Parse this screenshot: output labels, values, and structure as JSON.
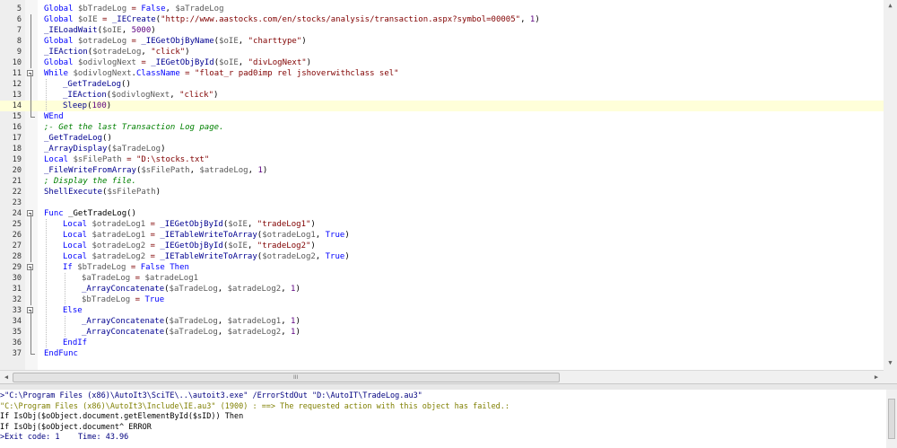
{
  "editor": {
    "current_line": 9,
    "lines": [
      {
        "n": "5",
        "fold": "line",
        "guides": [],
        "tokens": [
          [
            "kw",
            "Global "
          ],
          [
            "var",
            "$bTradeLog"
          ],
          [
            "op",
            " = "
          ],
          [
            "kw",
            "False"
          ],
          [
            "pn",
            ", "
          ],
          [
            "var",
            "$aTradeLog"
          ]
        ]
      },
      {
        "n": "6",
        "fold": "line",
        "guides": [],
        "tokens": [
          [
            "kw",
            "Global "
          ],
          [
            "var",
            "$oIE"
          ],
          [
            "op",
            " = "
          ],
          [
            "fn",
            "_IECreate"
          ],
          [
            "pn",
            "("
          ],
          [
            "str",
            "\"http://www.aastocks.com/en/stocks/analysis/transaction.aspx?symbol=00005\""
          ],
          [
            "pn",
            ", "
          ],
          [
            "num",
            "1"
          ],
          [
            "pn",
            ")"
          ]
        ]
      },
      {
        "n": "7",
        "fold": "line",
        "guides": [],
        "tokens": [
          [
            "fn",
            "_IELoadWait"
          ],
          [
            "pn",
            "("
          ],
          [
            "var",
            "$oIE"
          ],
          [
            "pn",
            ", "
          ],
          [
            "num",
            "5000"
          ],
          [
            "pn",
            ")"
          ]
        ]
      },
      {
        "n": "8",
        "fold": "line",
        "guides": [],
        "tokens": [
          [
            "kw",
            "Global "
          ],
          [
            "var",
            "$otradeLog"
          ],
          [
            "op",
            " = "
          ],
          [
            "fn",
            "_IEGetObjByName"
          ],
          [
            "pn",
            "("
          ],
          [
            "var",
            "$oIE"
          ],
          [
            "pn",
            ", "
          ],
          [
            "str",
            "\"charttype\""
          ],
          [
            "pn",
            ")"
          ]
        ]
      },
      {
        "n": "9",
        "fold": "line",
        "guides": [],
        "tokens": [
          [
            "fn",
            "_IEAction"
          ],
          [
            "pn",
            "("
          ],
          [
            "var",
            "$otradeLog"
          ],
          [
            "pn",
            ", "
          ],
          [
            "str",
            "\"click\""
          ],
          [
            "pn",
            ")"
          ]
        ]
      },
      {
        "n": "10",
        "fold": "line",
        "guides": [],
        "tokens": [
          [
            "kw",
            "Global "
          ],
          [
            "var",
            "$odivlogNext"
          ],
          [
            "op",
            " = "
          ],
          [
            "fn",
            "_IEGetObjById"
          ],
          [
            "pn",
            "("
          ],
          [
            "var",
            "$oIE"
          ],
          [
            "pn",
            ", "
          ],
          [
            "str",
            "\"divLogNext\""
          ],
          [
            "pn",
            ")"
          ]
        ]
      },
      {
        "n": "11",
        "fold": "open",
        "guides": [],
        "tokens": [
          [
            "kw",
            "While "
          ],
          [
            "var",
            "$odivlogNext"
          ],
          [
            "pn",
            "."
          ],
          [
            "ml",
            "ClassName"
          ],
          [
            "op",
            " = "
          ],
          [
            "str",
            "\"float_r pad0imp rel jshoverwithclass sel\""
          ]
        ]
      },
      {
        "n": "12",
        "fold": "line",
        "guides": [
          1
        ],
        "tokens": [
          [
            "fn",
            "_GetTradeLog"
          ],
          [
            "pn",
            "()"
          ]
        ]
      },
      {
        "n": "13",
        "fold": "line",
        "guides": [
          1
        ],
        "tokens": [
          [
            "fn",
            "_IEAction"
          ],
          [
            "pn",
            "("
          ],
          [
            "var",
            "$odivlogNext"
          ],
          [
            "pn",
            ", "
          ],
          [
            "str",
            "\"click\""
          ],
          [
            "pn",
            ")"
          ]
        ]
      },
      {
        "n": "14",
        "fold": "line",
        "guides": [
          1
        ],
        "tokens": [
          [
            "bi",
            "Sleep"
          ],
          [
            "pn",
            "("
          ],
          [
            "num",
            "100"
          ],
          [
            "pn",
            ")"
          ]
        ]
      },
      {
        "n": "15",
        "fold": "end",
        "guides": [],
        "tokens": [
          [
            "kw",
            "WEnd"
          ]
        ]
      },
      {
        "n": "16",
        "fold": "none",
        "guides": [],
        "tokens": [
          [
            "cm",
            ";- Get the last Transaction Log page."
          ]
        ]
      },
      {
        "n": "17",
        "fold": "none",
        "guides": [],
        "tokens": [
          [
            "fn",
            "_GetTradeLog"
          ],
          [
            "pn",
            "()"
          ]
        ]
      },
      {
        "n": "18",
        "fold": "none",
        "guides": [],
        "tokens": [
          [
            "fn",
            "_ArrayDisplay"
          ],
          [
            "pn",
            "("
          ],
          [
            "var",
            "$aTradeLog"
          ],
          [
            "pn",
            ")"
          ]
        ]
      },
      {
        "n": "19",
        "fold": "none",
        "guides": [],
        "tokens": [
          [
            "kw",
            "Local "
          ],
          [
            "var",
            "$sFilePath"
          ],
          [
            "op",
            " = "
          ],
          [
            "str",
            "\"D:\\stocks.txt\""
          ]
        ]
      },
      {
        "n": "20",
        "fold": "none",
        "guides": [],
        "tokens": [
          [
            "fn",
            "_FileWriteFromArray"
          ],
          [
            "pn",
            "("
          ],
          [
            "var",
            "$sFilePath"
          ],
          [
            "pn",
            ", "
          ],
          [
            "var",
            "$atradeLog"
          ],
          [
            "pn",
            ", "
          ],
          [
            "num",
            "1"
          ],
          [
            "pn",
            ")"
          ]
        ]
      },
      {
        "n": "21",
        "fold": "none",
        "guides": [],
        "tokens": [
          [
            "cm",
            "; Display the file."
          ]
        ]
      },
      {
        "n": "22",
        "fold": "none",
        "guides": [],
        "tokens": [
          [
            "bi",
            "ShellExecute"
          ],
          [
            "pn",
            "("
          ],
          [
            "var",
            "$sFilePath"
          ],
          [
            "pn",
            ")"
          ]
        ]
      },
      {
        "n": "23",
        "fold": "none",
        "guides": [],
        "tokens": []
      },
      {
        "n": "24",
        "fold": "open",
        "guides": [],
        "tokens": [
          [
            "kw",
            "Func "
          ],
          [
            "pn",
            "_GetTradeLog"
          ],
          [
            "pn",
            "()"
          ]
        ]
      },
      {
        "n": "25",
        "fold": "line",
        "guides": [
          1
        ],
        "tokens": [
          [
            "kw",
            "Local "
          ],
          [
            "var",
            "$otradeLog1"
          ],
          [
            "op",
            " = "
          ],
          [
            "fn",
            "_IEGetObjById"
          ],
          [
            "pn",
            "("
          ],
          [
            "var",
            "$oIE"
          ],
          [
            "pn",
            ", "
          ],
          [
            "str",
            "\"tradeLog1\""
          ],
          [
            "pn",
            ")"
          ]
        ]
      },
      {
        "n": "26",
        "fold": "line",
        "guides": [
          1
        ],
        "tokens": [
          [
            "kw",
            "Local "
          ],
          [
            "var",
            "$atradeLog1"
          ],
          [
            "op",
            " = "
          ],
          [
            "fn",
            "_IETableWriteToArray"
          ],
          [
            "pn",
            "("
          ],
          [
            "var",
            "$otradeLog1"
          ],
          [
            "pn",
            ", "
          ],
          [
            "kw",
            "True"
          ],
          [
            "pn",
            ")"
          ]
        ]
      },
      {
        "n": "27",
        "fold": "line",
        "guides": [
          1
        ],
        "tokens": [
          [
            "kw",
            "Local "
          ],
          [
            "var",
            "$otradeLog2"
          ],
          [
            "op",
            " = "
          ],
          [
            "fn",
            "_IEGetObjById"
          ],
          [
            "pn",
            "("
          ],
          [
            "var",
            "$oIE"
          ],
          [
            "pn",
            ", "
          ],
          [
            "str",
            "\"tradeLog2\""
          ],
          [
            "pn",
            ")"
          ]
        ]
      },
      {
        "n": "28",
        "fold": "line",
        "guides": [
          1
        ],
        "tokens": [
          [
            "kw",
            "Local "
          ],
          [
            "var",
            "$atradeLog2"
          ],
          [
            "op",
            " = "
          ],
          [
            "fn",
            "_IETableWriteToArray"
          ],
          [
            "pn",
            "("
          ],
          [
            "var",
            "$otradeLog2"
          ],
          [
            "pn",
            ", "
          ],
          [
            "kw",
            "True"
          ],
          [
            "pn",
            ")"
          ]
        ]
      },
      {
        "n": "29",
        "fold": "open",
        "guides": [
          1
        ],
        "tokens": [
          [
            "kw",
            "If "
          ],
          [
            "var",
            "$bTradeLog"
          ],
          [
            "op",
            " = "
          ],
          [
            "kw",
            "False Then"
          ]
        ]
      },
      {
        "n": "30",
        "fold": "line",
        "guides": [
          1,
          2
        ],
        "tokens": [
          [
            "var",
            "$aTradeLog"
          ],
          [
            "op",
            " = "
          ],
          [
            "var",
            "$atradeLog1"
          ]
        ]
      },
      {
        "n": "31",
        "fold": "line",
        "guides": [
          1,
          2
        ],
        "tokens": [
          [
            "fn",
            "_ArrayConcatenate"
          ],
          [
            "pn",
            "("
          ],
          [
            "var",
            "$aTradeLog"
          ],
          [
            "pn",
            ", "
          ],
          [
            "var",
            "$atradeLog2"
          ],
          [
            "pn",
            ", "
          ],
          [
            "num",
            "1"
          ],
          [
            "pn",
            ")"
          ]
        ]
      },
      {
        "n": "32",
        "fold": "line",
        "guides": [
          1,
          2
        ],
        "tokens": [
          [
            "var",
            "$bTradeLog"
          ],
          [
            "op",
            " = "
          ],
          [
            "kw",
            "True"
          ]
        ]
      },
      {
        "n": "33",
        "fold": "mid",
        "guides": [
          1
        ],
        "tokens": [
          [
            "kw",
            "Else"
          ]
        ]
      },
      {
        "n": "34",
        "fold": "line",
        "guides": [
          1,
          2
        ],
        "tokens": [
          [
            "fn",
            "_ArrayConcatenate"
          ],
          [
            "pn",
            "("
          ],
          [
            "var",
            "$aTradeLog"
          ],
          [
            "pn",
            ", "
          ],
          [
            "var",
            "$atradeLog1"
          ],
          [
            "pn",
            ", "
          ],
          [
            "num",
            "1"
          ],
          [
            "pn",
            ")"
          ]
        ]
      },
      {
        "n": "35",
        "fold": "line",
        "guides": [
          1,
          2
        ],
        "tokens": [
          [
            "fn",
            "_ArrayConcatenate"
          ],
          [
            "pn",
            "("
          ],
          [
            "var",
            "$aTradeLog"
          ],
          [
            "pn",
            ", "
          ],
          [
            "var",
            "$atradeLog2"
          ],
          [
            "pn",
            ", "
          ],
          [
            "num",
            "1"
          ],
          [
            "pn",
            ")"
          ]
        ]
      },
      {
        "n": "36",
        "fold": "line",
        "guides": [
          1
        ],
        "tokens": [
          [
            "kw",
            "EndIf"
          ]
        ]
      },
      {
        "n": "37",
        "fold": "end",
        "guides": [],
        "tokens": [
          [
            "kw",
            "EndFunc"
          ]
        ]
      }
    ]
  },
  "scrollbar": {
    "up_arrow": "▲",
    "down_arrow": "▼",
    "left_arrow": "◀",
    "right_arrow": "▶",
    "grip": "III"
  },
  "output": {
    "lines": [
      {
        "cls": "o-cmd",
        "text": ">\"C:\\Program Files (x86)\\AutoIt3\\SciTE\\..\\autoit3.exe\" /ErrorStdOut \"D:\\AutoIT\\TradeLog.au3\""
      },
      {
        "cls": "o-err",
        "text": "\"C:\\Program Files (x86)\\AutoIt3\\Include\\IE.au3\" (1900) : ==> The requested action with this object has failed.:"
      },
      {
        "cls": "o-txt",
        "text": "If IsObj($oObject.document.getElementById($sID)) Then"
      },
      {
        "cls": "o-txt",
        "text": "If IsObj($oObject.document^ ERROR"
      },
      {
        "cls": "o-exit",
        "text": ">Exit code: 1    Time: 43.96"
      }
    ]
  },
  "colors": {
    "current_line": "#ffffd9",
    "keyword": "#0000ff",
    "string": "#800000",
    "comment": "#008000"
  }
}
